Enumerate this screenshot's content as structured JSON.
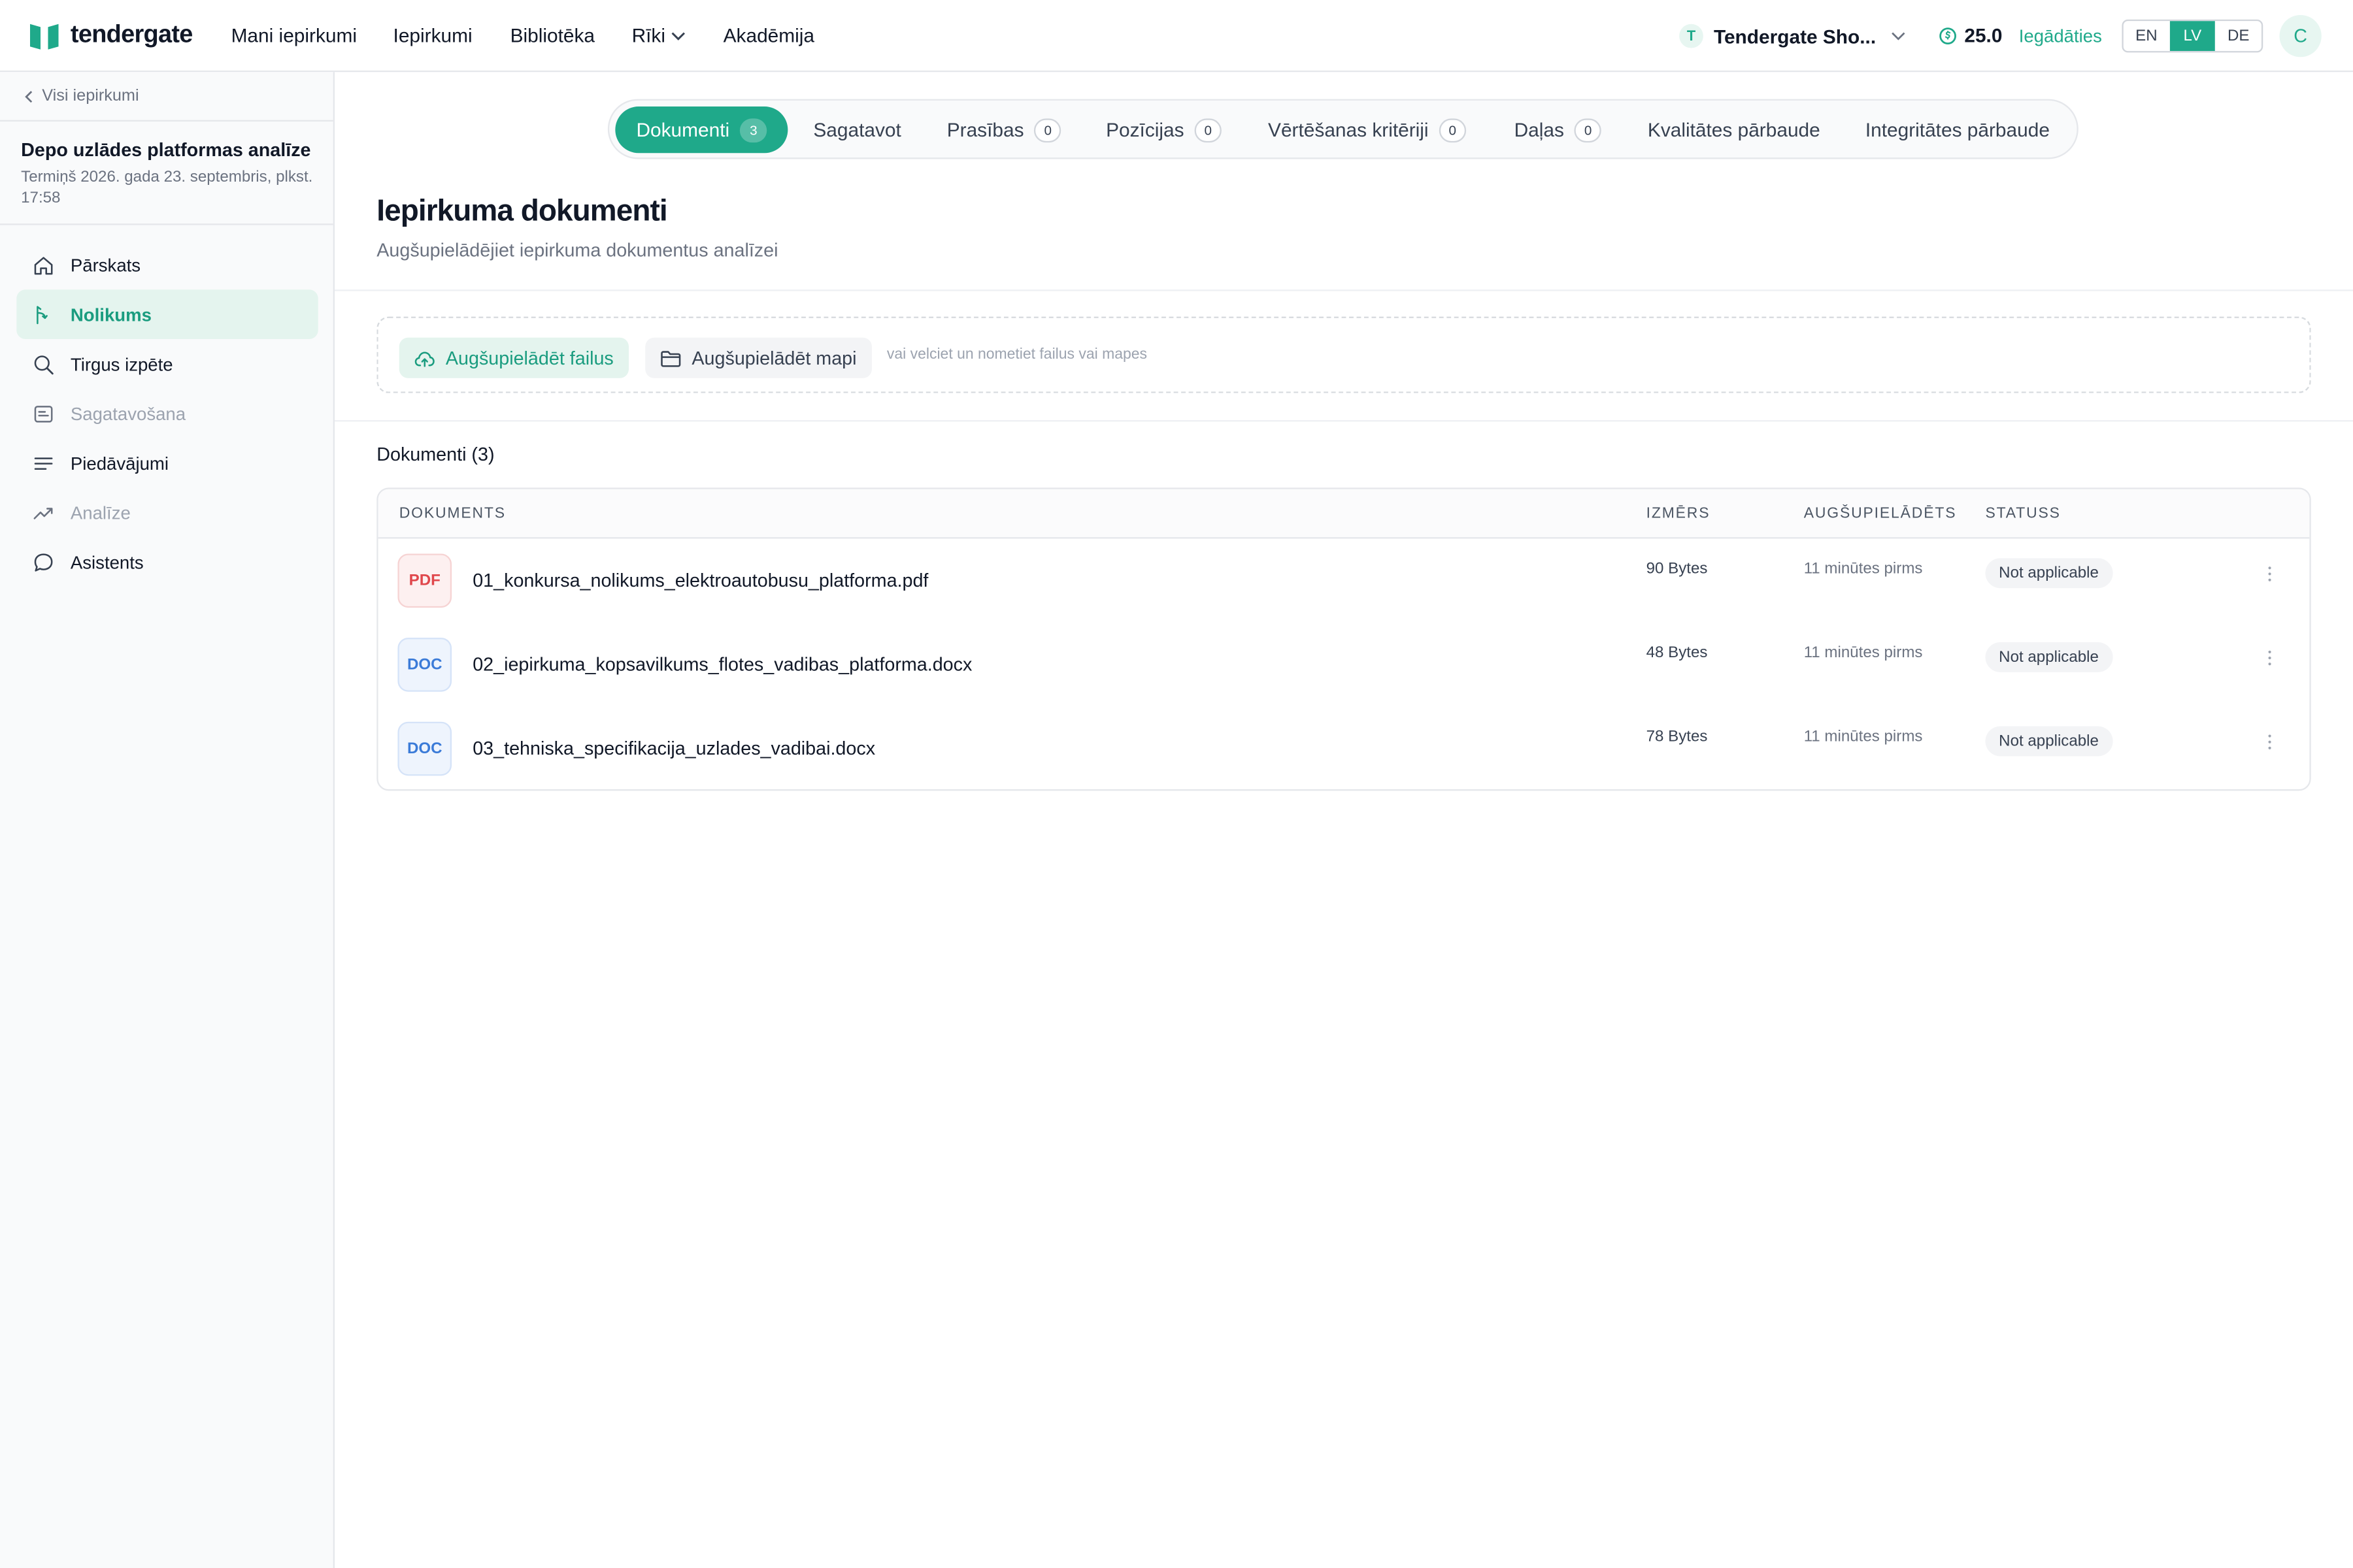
{
  "header": {
    "logo_text": "tendergate",
    "nav": [
      {
        "label": "Mani iepirkumi"
      },
      {
        "label": "Iepirkumi"
      },
      {
        "label": "Bibliotēka"
      },
      {
        "label": "Rīki"
      },
      {
        "label": "Akadēmija"
      }
    ],
    "org_initial": "T",
    "org_name": "Tendergate Sho...",
    "credits": "25.0",
    "credits_link": "Iegādāties",
    "languages": [
      "EN",
      "LV",
      "DE"
    ],
    "active_language": "LV",
    "user_initial": "C"
  },
  "sidebar": {
    "back_label": "Visi iepirkumi",
    "project_title": "Depo uzlādes platformas analīze",
    "project_deadline": "Termiņš 2026. gada 23. septembris, plkst. 17:58",
    "items": [
      {
        "label": "Pārskats",
        "icon": "home-icon",
        "state": "normal"
      },
      {
        "label": "Nolikums",
        "icon": "document-branch-icon",
        "state": "active"
      },
      {
        "label": "Tirgus izpēte",
        "icon": "search-icon",
        "state": "normal"
      },
      {
        "label": "Sagatavošana",
        "icon": "notepad-icon",
        "state": "muted"
      },
      {
        "label": "Piedāvājumi",
        "icon": "lines-icon",
        "state": "normal"
      },
      {
        "label": "Analīze",
        "icon": "trend-icon",
        "state": "muted"
      },
      {
        "label": "Asistents",
        "icon": "chat-icon",
        "state": "normal"
      }
    ]
  },
  "tabs": [
    {
      "label": "Dokumenti",
      "badge": "3",
      "active": true
    },
    {
      "label": "Sagatavot",
      "badge": null
    },
    {
      "label": "Prasības",
      "badge": "0"
    },
    {
      "label": "Pozīcijas",
      "badge": "0"
    },
    {
      "label": "Vērtēšanas kritēriji",
      "badge": "0"
    },
    {
      "label": "Daļas",
      "badge": "0"
    },
    {
      "label": "Kvalitātes pārbaude",
      "badge": null
    },
    {
      "label": "Integritātes pārbaude",
      "badge": null
    }
  ],
  "page": {
    "title": "Iepirkuma dokumenti",
    "subtitle": "Augšupielādējiet iepirkuma dokumentus analīzei"
  },
  "upload": {
    "files_label": "Augšupielādēt failus",
    "folder_label": "Augšupielādēt mapi",
    "hint": "vai velciet un nometiet failus vai mapes"
  },
  "documents": {
    "count_label": "Dokumenti (3)",
    "columns": [
      "DOKUMENTS",
      "IZMĒRS",
      "AUGŠUPIELĀDĒTS",
      "STATUSS"
    ],
    "rows": [
      {
        "type": "PDF",
        "name": "01_konkursa_nolikums_elektroautobusu_platforma.pdf",
        "size": "90 Bytes",
        "uploaded": "11 minūtes pirms",
        "status": "Not applicable"
      },
      {
        "type": "DOC",
        "name": "02_iepirkuma_kopsavilkums_flotes_vadibas_platforma.docx",
        "size": "48 Bytes",
        "uploaded": "11 minūtes pirms",
        "status": "Not applicable"
      },
      {
        "type": "DOC",
        "name": "03_tehniska_specifikacija_uzlades_vadibai.docx",
        "size": "78 Bytes",
        "uploaded": "11 minūtes pirms",
        "status": "Not applicable"
      }
    ]
  },
  "colors": {
    "accent": "#1fa98a",
    "accent_soft": "#e4f4ee",
    "pdf": "#e0474c",
    "doc": "#3b7bd8"
  }
}
